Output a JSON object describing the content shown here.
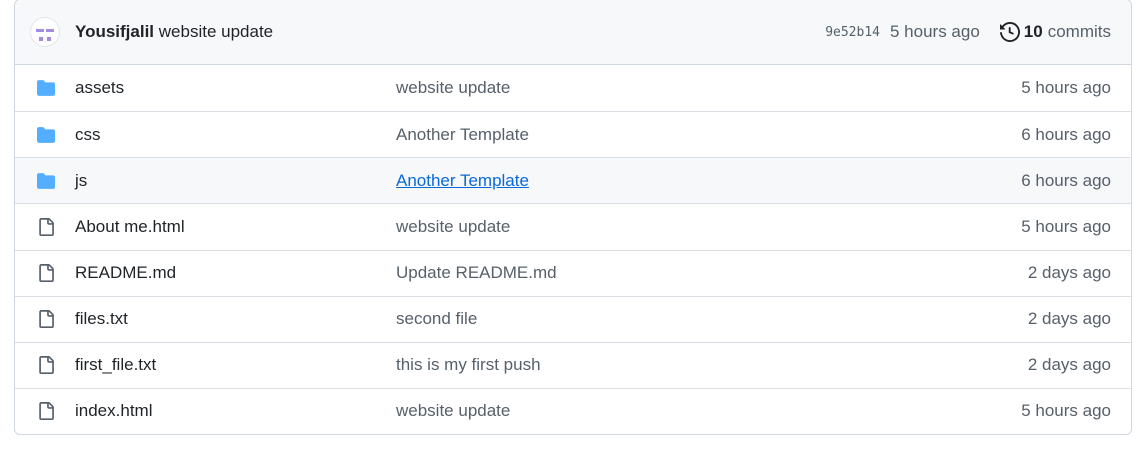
{
  "commit_header": {
    "author": "Yousifjalil",
    "message": "website update",
    "sha": "9e52b14",
    "time": "5 hours ago",
    "commit_count": "10",
    "commits_label": "commits",
    "avatar_color": "#a48be0",
    "history_icon": "history-icon"
  },
  "colors": {
    "folder": "#54aeff",
    "file": "#57606a",
    "link": "#0969da"
  },
  "files": [
    {
      "type": "folder",
      "name": "assets",
      "message": "website update",
      "time": "5 hours ago"
    },
    {
      "type": "folder",
      "name": "css",
      "message": "Another Template",
      "time": "6 hours ago"
    },
    {
      "type": "folder",
      "name": "js",
      "message": "Another Template",
      "time": "6 hours ago"
    },
    {
      "type": "file",
      "name": "About me.html",
      "message": "website update",
      "time": "5 hours ago"
    },
    {
      "type": "file",
      "name": "README.md",
      "message": "Update README.md",
      "time": "2 days ago"
    },
    {
      "type": "file",
      "name": "files.txt",
      "message": "second file",
      "time": "2 days ago"
    },
    {
      "type": "file",
      "name": "first_file.txt",
      "message": "this is my first push",
      "time": "2 days ago"
    },
    {
      "type": "file",
      "name": "index.html",
      "message": "website update",
      "time": "5 hours ago"
    }
  ]
}
